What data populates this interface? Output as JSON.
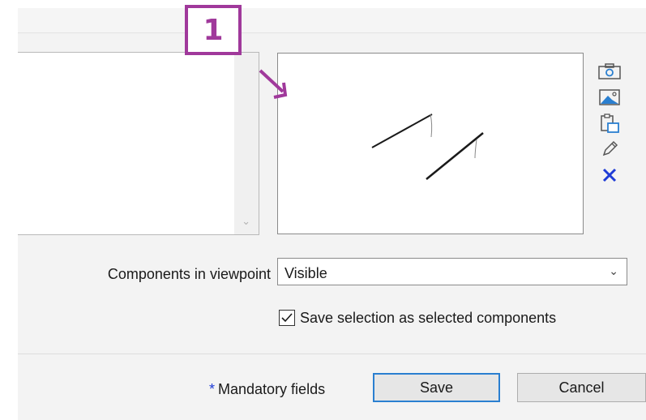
{
  "annotation": {
    "number": "1",
    "color": "#a0399b"
  },
  "viewpoint": {
    "side_icons": [
      {
        "name": "camera-icon",
        "label": "Take snapshot"
      },
      {
        "name": "image-icon",
        "label": "Load image"
      },
      {
        "name": "clipboard-icon",
        "label": "Paste image"
      },
      {
        "name": "pencil-icon",
        "label": "Edit"
      },
      {
        "name": "delete-icon",
        "label": "Delete"
      }
    ]
  },
  "components": {
    "label": "Components in viewpoint",
    "selected_value": "Visible",
    "checkbox_label": "Save selection as selected components",
    "checkbox_checked": true
  },
  "footer": {
    "asterisk": "*",
    "mandatory_text": "Mandatory fields",
    "save_label": "Save",
    "cancel_label": "Cancel"
  },
  "colors": {
    "accent": "#2a7fd0",
    "delete": "#1e3bd6",
    "mandatory_asterisk": "#1e3bd6"
  }
}
